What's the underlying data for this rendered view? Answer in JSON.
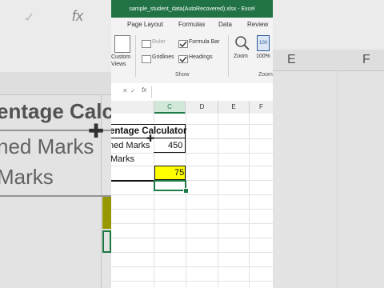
{
  "window": {
    "title": "sample_student_data(AutoRecovered).xlsx  -  Excel"
  },
  "tabs": [
    "Page Layout",
    "Formulas",
    "Data",
    "Review"
  ],
  "ribbon": {
    "custom_views": "Custom Views",
    "ruler": "Ruler",
    "gridlines": "Gridlines",
    "formula_bar": "Formula Bar",
    "headings": "Headings",
    "group_show": "Show",
    "zoom": "Zoom",
    "zoom_100": "100%",
    "group_zoom": "Zoom"
  },
  "formula_bar": {
    "fx": "fx"
  },
  "columns": [
    "C",
    "D",
    "E",
    "F"
  ],
  "cells": {
    "header": "entage Calculator",
    "obtained_label": "ned Marks",
    "obtained_value": "450",
    "total_label": "Marks",
    "percentage_value": "75"
  },
  "background_left": {
    "fx": "fx",
    "line1": "entage Calc",
    "line2": "ned Marks",
    "line3": "Marks"
  },
  "background_right": {
    "col_e": "E",
    "col_f": "F"
  },
  "colors": {
    "excel_green": "#217346",
    "highlight_yellow": "#ffff00",
    "selection_green": "#1e7b45"
  }
}
